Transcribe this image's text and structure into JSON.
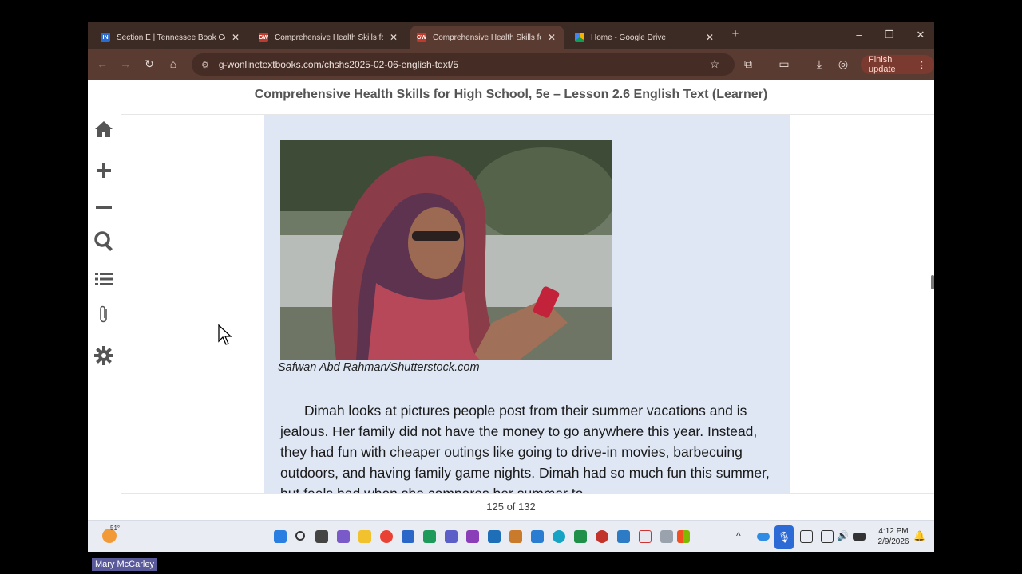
{
  "browser": {
    "tabs": [
      {
        "title": "Section E | Tennessee Book Co.",
        "favicon": "IN",
        "favicon_color": "#2a6bd0",
        "active": false
      },
      {
        "title": "Comprehensive Health Skills fo",
        "favicon": "GW",
        "favicon_color": "#c0392b",
        "active": false
      },
      {
        "title": "Comprehensive Health Skills fo",
        "favicon": "GW",
        "favicon_color": "#c0392b",
        "active": true
      },
      {
        "title": "Home - Google Drive",
        "favicon": "drive-icon",
        "favicon_color": "#f4b400",
        "active": false
      }
    ],
    "new_tab": "+",
    "window_controls": {
      "minimize": "–",
      "restore": "❐",
      "close": "✕"
    },
    "url": "g-wonlinetextbooks.com/chshs2025-02-06-english-text/5",
    "finish_update": "Finish update"
  },
  "reader": {
    "title": "Comprehensive Health Skills for High School, 5e – Lesson 2.6 English Text (Learner)",
    "tools": [
      "home-icon",
      "zoom-in-icon",
      "zoom-out-icon",
      "search-icon",
      "toc-icon",
      "attachment-icon",
      "settings-icon"
    ],
    "photo_credit": "Safwan Abd Rahman/Shutterstock.com",
    "paragraph": "Dimah looks at pictures people post from their summer vacations and is jealous. Her family did not have the money to go anywhere this year. Instead, they had fun with cheaper outings like going to drive-in movies, barbecuing outdoors, and having family game nights. Dimah had so much fun this summer, but feels bad when she compares her summer to",
    "page_counter": "125 of 132"
  },
  "taskbar": {
    "weather_temp": "51°",
    "time": "4:12 PM",
    "date": "2/9/2026"
  },
  "user_tag": "Mary McCarley"
}
